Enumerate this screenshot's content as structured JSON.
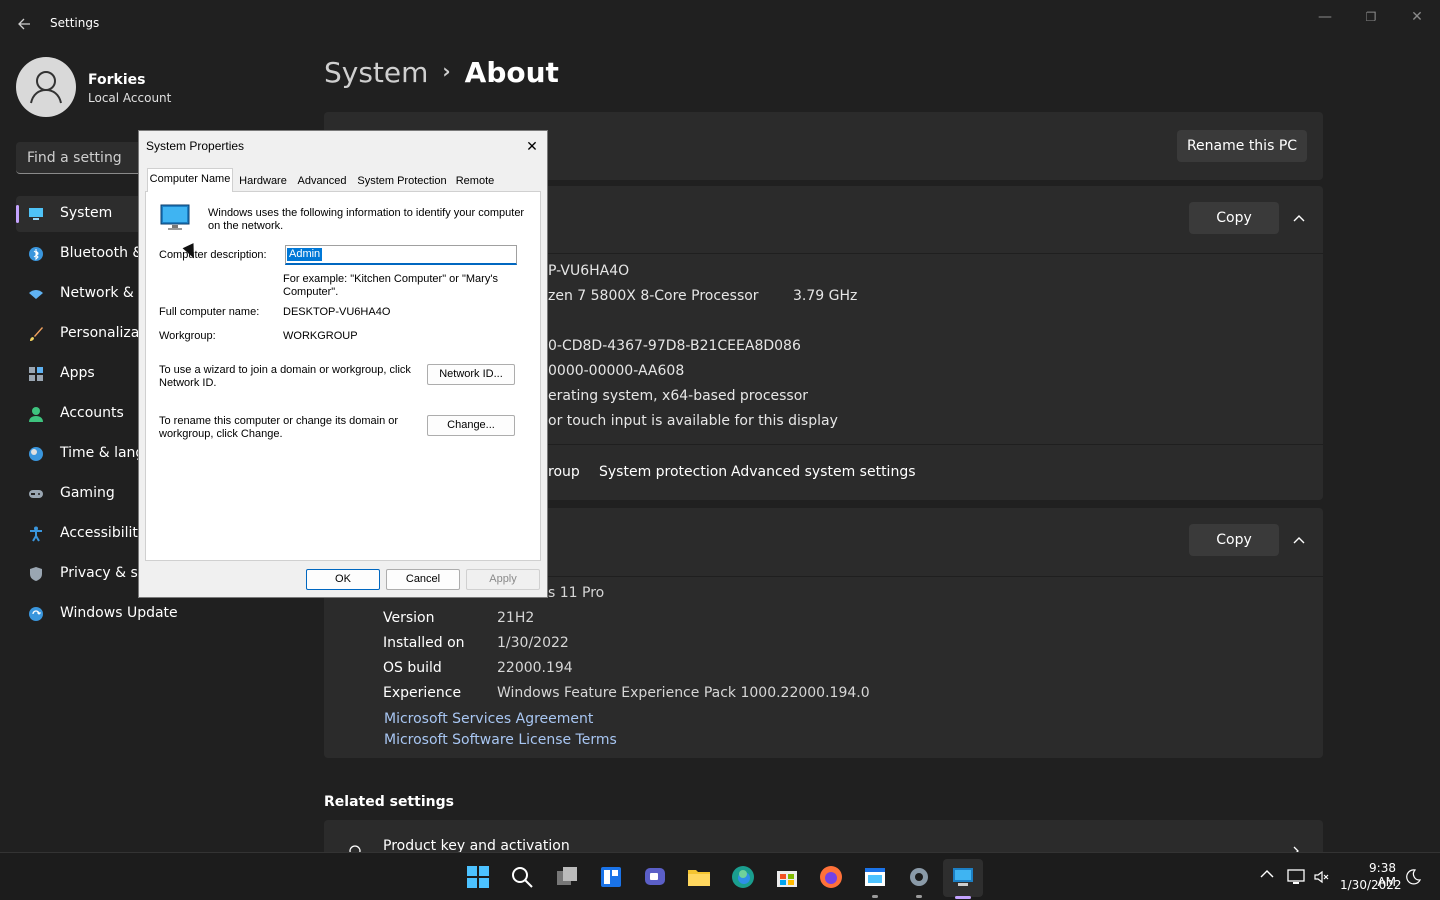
{
  "app": {
    "title": "Settings"
  },
  "window_controls": {
    "minimize": "—",
    "maximize": "❐",
    "close": "✕"
  },
  "profile": {
    "name": "Forkies",
    "account_type": "Local Account"
  },
  "search": {
    "placeholder": "Find a setting"
  },
  "sidebar": {
    "items": [
      {
        "label": "System",
        "icon": "monitor-icon",
        "color": "#4fc3f7"
      },
      {
        "label": "Bluetooth &",
        "icon": "bluetooth-icon",
        "color": "#3a96dd"
      },
      {
        "label": "Network & i",
        "icon": "wifi-icon",
        "color": "#5fb2f2"
      },
      {
        "label": "Personalizati",
        "icon": "brush-icon",
        "color": "#f2a25f"
      },
      {
        "label": "Apps",
        "icon": "apps-icon",
        "color": "#9aa6b2"
      },
      {
        "label": "Accounts",
        "icon": "person-icon",
        "color": "#3ec37e"
      },
      {
        "label": "Time & lang",
        "icon": "clock-globe-icon",
        "color": "#3a96dd"
      },
      {
        "label": "Gaming",
        "icon": "gamepad-icon",
        "color": "#9aa6b2"
      },
      {
        "label": "Accessibility",
        "icon": "accessibility-icon",
        "color": "#3a96dd"
      },
      {
        "label": "Privacy & se",
        "icon": "shield-icon",
        "color": "#9aa6b2"
      },
      {
        "label": "Windows Update",
        "icon": "update-icon",
        "color": "#3a96dd"
      }
    ]
  },
  "breadcrumb": {
    "parent": "System",
    "separator": "›",
    "current": "About"
  },
  "device_card": {
    "rename_button": "Rename this PC"
  },
  "device_specs": {
    "copy_button": "Copy",
    "lines": [
      "P-VU6HA4O",
      "zen 7 5800X 8-Core Processor",
      "3.79 GHz",
      "0-CD8D-4367-97D8-B21CEEA8D086",
      "0000-00000-AA608",
      "erating system, x64-based processor",
      "or touch input is available for this display"
    ]
  },
  "related_links": {
    "items": [
      "roup",
      "System protection",
      "Advanced system settings"
    ]
  },
  "windows_specs": {
    "copy_button": "Copy",
    "edition_value": "s 11 Pro",
    "rows": [
      {
        "label": "Version",
        "value": "21H2"
      },
      {
        "label": "Installed on",
        "value": "1/30/2022"
      },
      {
        "label": "OS build",
        "value": "22000.194"
      },
      {
        "label": "Experience",
        "value": "Windows Feature Experience Pack 1000.22000.194.0"
      }
    ],
    "links": [
      "Microsoft Services Agreement",
      "Microsoft Software License Terms"
    ]
  },
  "related_settings": {
    "header": "Related settings",
    "first_item": "Product key and activation"
  },
  "dialog": {
    "title": "System Properties",
    "close": "✕",
    "tabs": [
      "Computer Name",
      "Hardware",
      "Advanced",
      "System Protection",
      "Remote"
    ],
    "intro_line1": "Windows uses the following information to identify your computer",
    "intro_line2": "on the network.",
    "description_label": "Computer description:",
    "description_value": "Admin",
    "example_line1": "For example: \"Kitchen Computer\" or \"Mary's",
    "example_line2": "Computer\".",
    "full_name_label": "Full computer name:",
    "full_name_value": "DESKTOP-VU6HA4O",
    "workgroup_label": "Workgroup:",
    "workgroup_value": "WORKGROUP",
    "wizard_line1": "To use a wizard to join a domain or workgroup, click",
    "wizard_line2": "Network ID.",
    "network_id_button": "Network ID...",
    "rename_line1": "To rename this computer or change its domain or",
    "rename_line2": "workgroup, click Change.",
    "change_button": "Change...",
    "ok_button": "OK",
    "cancel_button": "Cancel",
    "apply_button": "Apply"
  },
  "taskbar": {
    "icons": [
      "windows-start-icon",
      "search-icon",
      "task-view-icon",
      "widgets-icon",
      "chat-icon",
      "file-explorer-icon",
      "edge-icon",
      "store-icon",
      "firefox-icon",
      "app-window-icon",
      "settings-gear-icon",
      "system-properties-icon"
    ],
    "tray": {
      "chevron": "^"
    },
    "time": "9:38 AM",
    "date": "1/30/2022"
  }
}
